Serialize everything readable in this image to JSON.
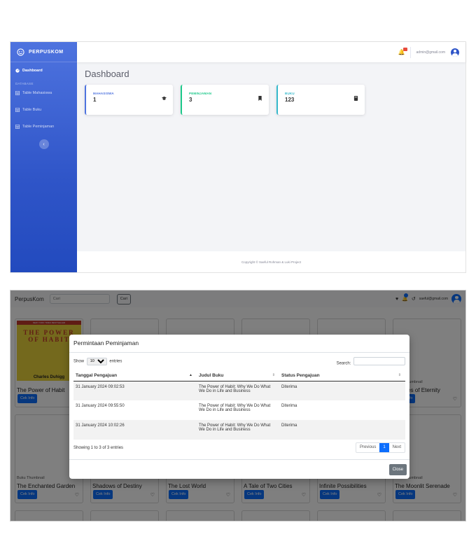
{
  "admin": {
    "brand": "PERPUSKOM",
    "sidebar": {
      "dashboard": "Dashboard",
      "heading": "DATABASE",
      "items": [
        "Table Mahasiswa",
        "Table Buku",
        "Table Peminjaman"
      ]
    },
    "email": "admin@gmail.com",
    "title": "Dashboard",
    "cards": [
      {
        "label": "MAHASISWA",
        "value": "1"
      },
      {
        "label": "PEMINJAMAN",
        "value": "3"
      },
      {
        "label": "BUKU",
        "value": "123"
      }
    ],
    "footer": "Copyright © Saeful Rohman & Luki Project"
  },
  "user": {
    "brand": "PerpusKom",
    "search_placeholder": "Cari",
    "search_button": "Cari",
    "email": "saeful@gmail.com",
    "book_thumb_alt": "Buku Thumbnail",
    "cover": {
      "band": "NEW YORK TIMES BESTSELLER",
      "title": "THE POWER OF HABIT",
      "author": "Charles Duhigg"
    },
    "cek_info": "Cek Info",
    "row1_titles": [
      "The Power of Habit",
      "",
      "",
      "",
      "",
      "Echoes of Eternity"
    ],
    "row2_titles": [
      "The Enchanted Garden",
      "Shadows of Destiny",
      "The Lost World",
      "A Tale of Two Cities",
      "Infinite Possibilities",
      "The Moonlit Serenade"
    ],
    "modal": {
      "title": "Permintaan Peminjaman",
      "show": "Show",
      "entries_value": "10",
      "entries": "entries",
      "search": "Search:",
      "headers": [
        "Tanggal Pengajuan",
        "Judul Buku",
        "Status Pengajuan"
      ],
      "rows": [
        {
          "date": "31 January 2024 09:02:53",
          "title": "The Power of Habit: Why We Do What We Do in Life and Business",
          "status": "Diterima"
        },
        {
          "date": "31 January 2024 09:55:50",
          "title": "The Power of Habit: Why We Do What We Do in Life and Business",
          "status": "Diterima"
        },
        {
          "date": "31 January 2024 10:02:26",
          "title": "The Power of Habit: Why We Do What We Do in Life and Business",
          "status": "Diterima"
        }
      ],
      "info": "Showing 1 to 3 of 3 entries",
      "prev": "Previous",
      "page": "1",
      "next": "Next",
      "close": "Close"
    }
  }
}
